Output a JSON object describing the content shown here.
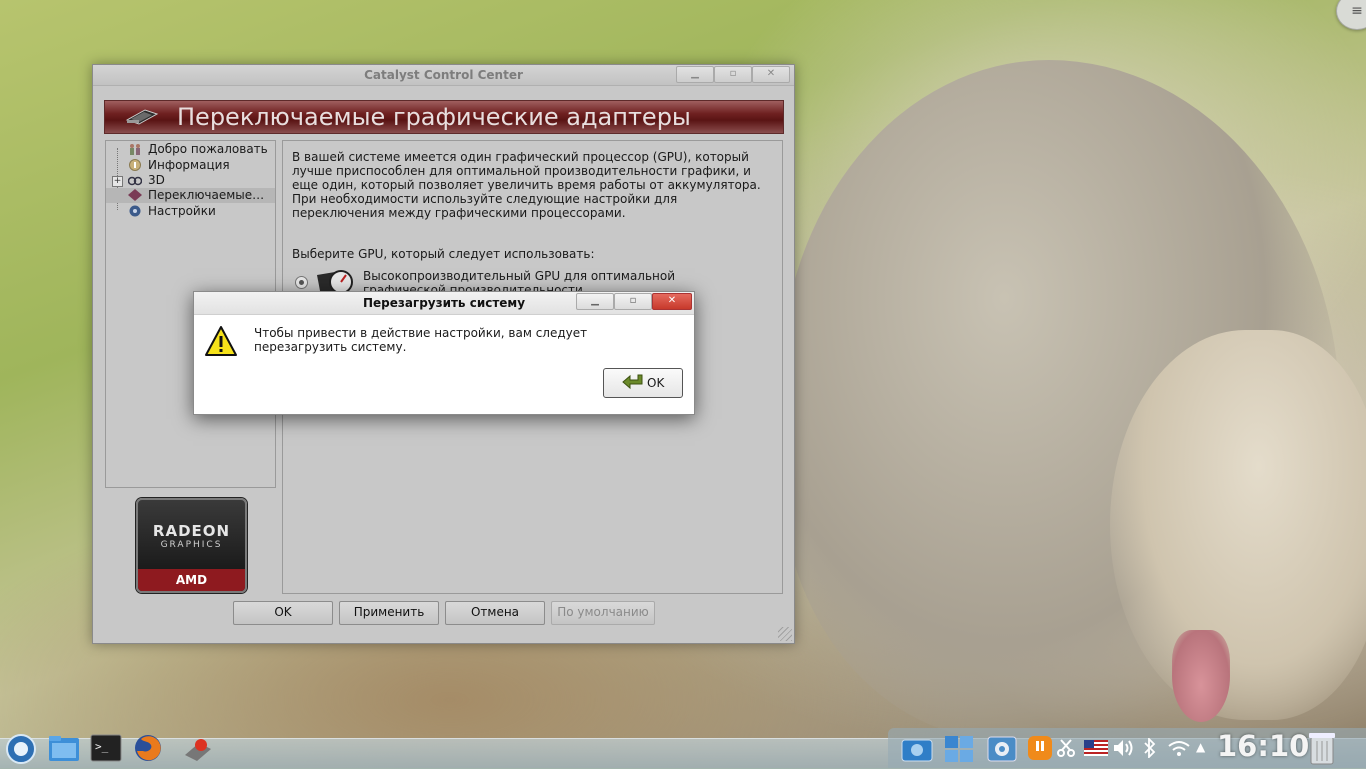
{
  "main_window": {
    "title": "Catalyst Control Center",
    "banner_title": "Переключаемые графические адаптеры",
    "tree": [
      {
        "label": "Добро пожаловать",
        "icon": "welcome-icon"
      },
      {
        "label": "Информация",
        "icon": "info-icon"
      },
      {
        "label": "3D",
        "icon": "3d-icon"
      },
      {
        "label": "Переключаемые…",
        "icon": "switchable-graphics-icon"
      },
      {
        "label": "Настройки",
        "icon": "settings-icon"
      }
    ],
    "logo": {
      "radeon": "RADEON",
      "graphics": "GRAPHICS",
      "amd": "AMD"
    },
    "content": {
      "description": [
        "В вашей системе имеется один графический процессор (GPU), который",
        "лучше приспособлен для оптимальной производительности графики, и",
        "еще один, который позволяет увеличить время работы от аккумулятора.",
        "При необходимости используйте следующие настройки для",
        "переключения между графическими процессорами."
      ],
      "choose_label": "Выберите GPU, который следует использовать:",
      "gpu_option": [
        "Высокопроизводительный GPU для оптимальной",
        "графической производительности"
      ]
    },
    "buttons": {
      "ok": "OK",
      "apply": "Применить",
      "cancel": "Отмена",
      "defaults": "По умолчанию"
    }
  },
  "dialog": {
    "title": "Перезагрузить систему",
    "message": [
      "Чтобы привести в действие настройки, вам следует",
      "перезагрузить систему."
    ],
    "ok": "OK"
  },
  "taskbar": {
    "launchers": [
      "app-launcher-icon",
      "file-manager-icon",
      "terminal-icon",
      "firefox-icon",
      "ati-tray-icon"
    ],
    "tray": [
      "screenshot-icon",
      "desktop-pager-icon",
      "package-updater-icon",
      "notifications-icon",
      "clipboard-icon",
      "keyboard-layout-flag-icon",
      "volume-icon",
      "bluetooth-icon",
      "wifi-icon",
      "expand-tray-icon",
      "trash-icon"
    ],
    "clock": "16:10"
  }
}
